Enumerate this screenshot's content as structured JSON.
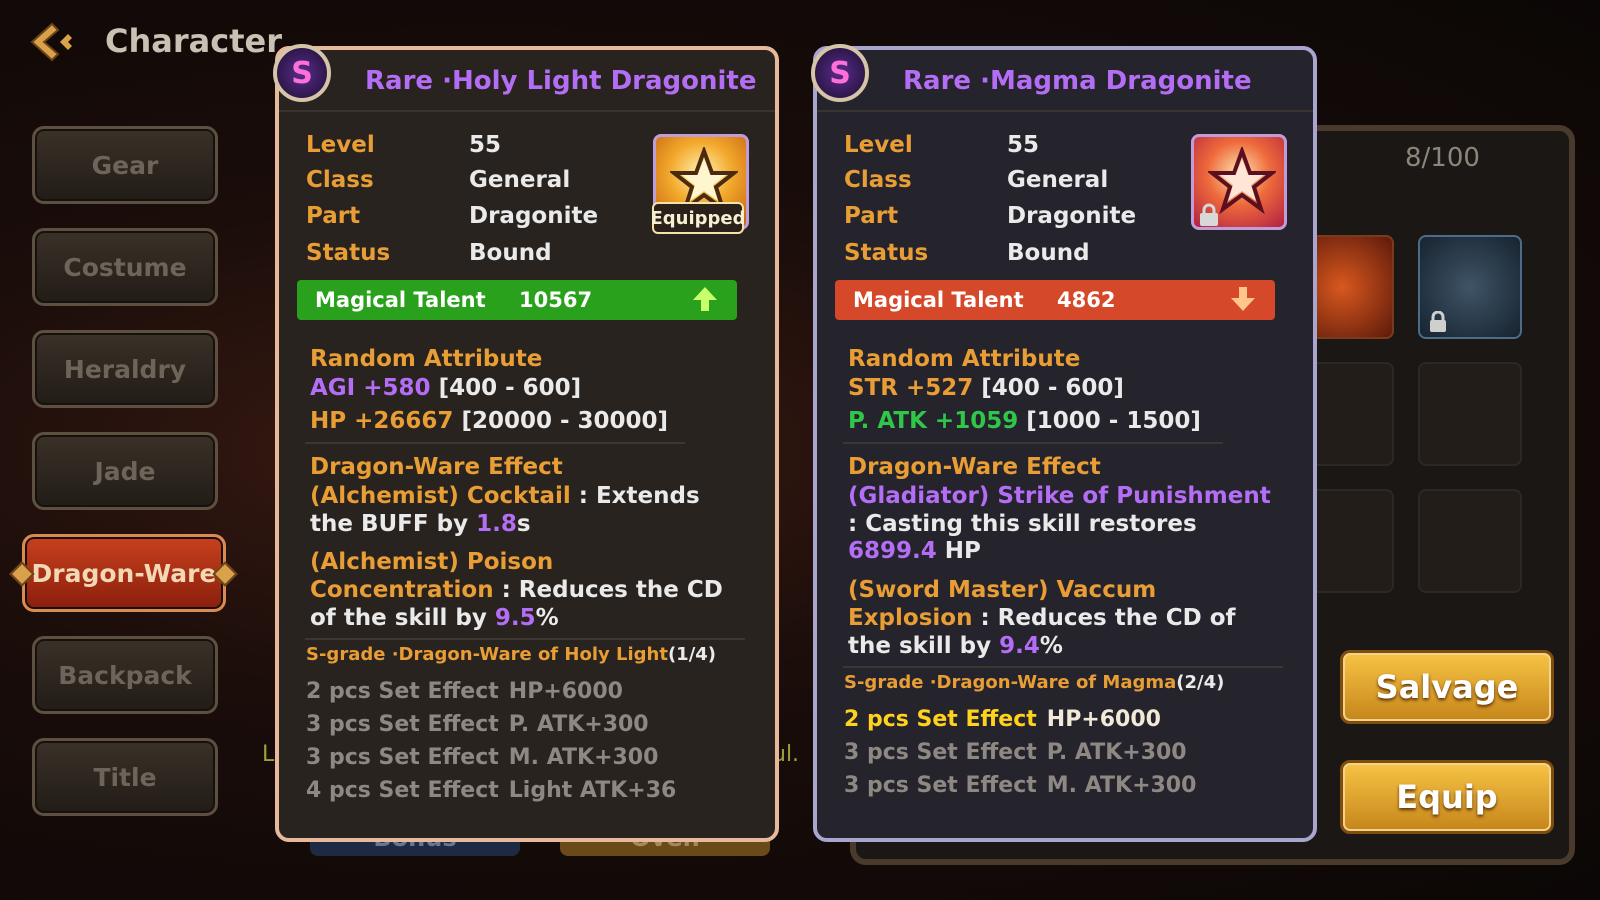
{
  "header": {
    "title": "Character"
  },
  "menu": {
    "items": [
      {
        "label": "Gear"
      },
      {
        "label": "Costume"
      },
      {
        "label": "Heraldry"
      },
      {
        "label": "Jade"
      },
      {
        "label": "Dragon-Ware"
      },
      {
        "label": "Backpack"
      },
      {
        "label": "Title"
      }
    ],
    "active": "Dragon-Ware"
  },
  "inventory": {
    "count": "8/100"
  },
  "actions": {
    "salvage_label": "Salvage",
    "equip_label": "Equip"
  },
  "bottom_tabs": {
    "bonus_label": "Bonus",
    "oven_label": "Oven"
  },
  "peek": {
    "left": "L",
    "right": "ul."
  },
  "cards": {
    "holy": {
      "grade": "S",
      "title": "Rare ·Holy Light Dragonite",
      "stats": {
        "level_label": "Level",
        "level_value": "55",
        "class_label": "Class",
        "class_value": "General",
        "part_label": "Part",
        "part_value": "Dragonite",
        "status_label": "Status",
        "status_value": "Bound"
      },
      "equipped_badge": "Equipped",
      "talent": {
        "label": "Magical Talent",
        "value": "10567",
        "trend": "up"
      },
      "random_attribute": {
        "title": "Random Attribute",
        "lines": [
          {
            "stat": "AGI",
            "bonus": "+580",
            "range": "[400 - 600]"
          },
          {
            "stat": "HP",
            "bonus": "+26667",
            "range": "[20000 - 30000]"
          }
        ]
      },
      "effect": {
        "title": "Dragon-Ware Effect",
        "e1_name": "(Alchemist) Cocktail",
        "e1_text_a": " : Extends",
        "e1_text_b": "the BUFF by ",
        "e1_num": "1.8",
        "e1_unit": "s",
        "e2_name_a": "(Alchemist) Poison",
        "e2_name_b": "Concentration",
        "e2_text_a": " : Reduces the CD",
        "e2_text_b": "of the skill by ",
        "e2_num": "9.5",
        "e2_unit": "%"
      },
      "set": {
        "title": "S-grade ·Dragon-Ware of Holy Light",
        "progress": "(1/4)",
        "lines": [
          {
            "label": "2 pcs Set Effect",
            "value": "HP+6000",
            "active": false
          },
          {
            "label": "3 pcs Set Effect",
            "value": "P. ATK+300",
            "active": false
          },
          {
            "label": "3 pcs Set Effect",
            "value": "M. ATK+300",
            "active": false
          },
          {
            "label": "4 pcs Set Effect",
            "value": "Light ATK+36",
            "active": false
          }
        ]
      }
    },
    "magma": {
      "grade": "S",
      "title": "Rare ·Magma Dragonite",
      "stats": {
        "level_label": "Level",
        "level_value": "55",
        "class_label": "Class",
        "class_value": "General",
        "part_label": "Part",
        "part_value": "Dragonite",
        "status_label": "Status",
        "status_value": "Bound"
      },
      "talent": {
        "label": "Magical Talent",
        "value": "4862",
        "trend": "down"
      },
      "random_attribute": {
        "title": "Random Attribute",
        "lines": [
          {
            "stat": "STR",
            "bonus": "+527",
            "range": "[400 - 600]"
          },
          {
            "stat": "P. ATK",
            "bonus": "+1059",
            "range": "[1000 - 1500]"
          }
        ]
      },
      "effect": {
        "title": "Dragon-Ware Effect",
        "e1_name": "(Gladiator) Strike of Punishment",
        "e1_text_a": ": Casting this skill restores",
        "e1_num": "6899.4",
        "e1_unit": " HP",
        "e2_name_a": "(Sword Master) Vaccum",
        "e2_name_b": "Explosion",
        "e2_text_a": " : Reduces the CD of",
        "e2_text_b": "the skill by ",
        "e2_num": "9.4",
        "e2_unit": "%"
      },
      "set": {
        "title": "S-grade ·Dragon-Ware of Magma",
        "progress": "(2/4)",
        "lines": [
          {
            "label": "2 pcs Set Effect",
            "value": "HP+6000",
            "active": true
          },
          {
            "label": "3 pcs Set Effect",
            "value": "P. ATK+300",
            "active": false
          },
          {
            "label": "3 pcs Set Effect",
            "value": "M. ATK+300",
            "active": false
          }
        ]
      }
    }
  },
  "colors": {
    "accent_purple": "#b46df5",
    "accent_orange": "#e89d35",
    "talent_up": "#29a11d",
    "talent_down": "#d5492a",
    "active_set": "#ffd21e"
  },
  "icons": {
    "back": "back-arrow-icon",
    "grade": "s-grade-icon",
    "holy_item": "holy-light-dragonite-icon",
    "magma_item": "magma-dragonite-icon",
    "lock": "lock-icon",
    "trend_up": "arrow-up-icon",
    "trend_down": "arrow-down-icon"
  }
}
